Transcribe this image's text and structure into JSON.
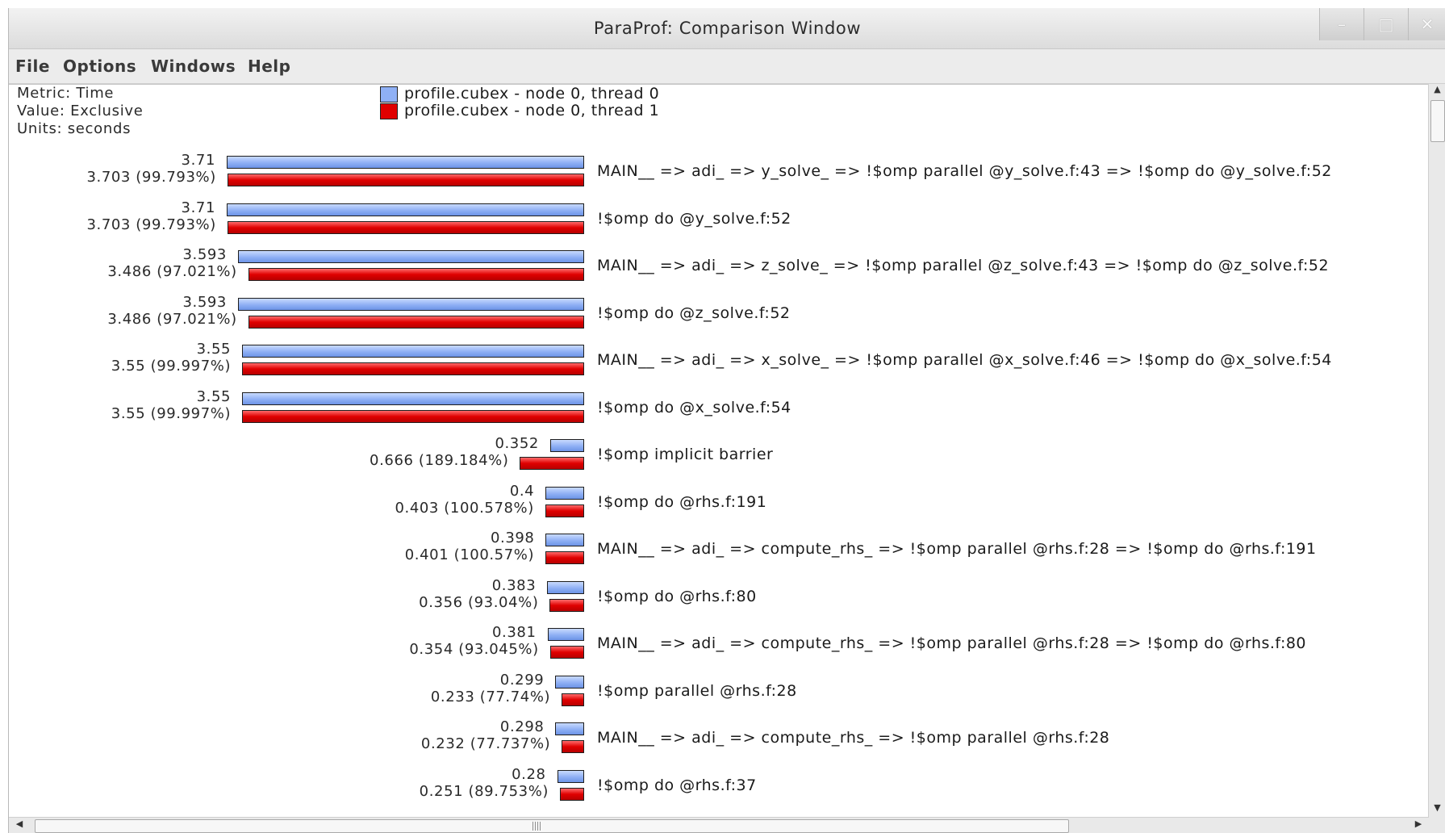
{
  "window": {
    "title": "ParaProf: Comparison Window",
    "controls": {
      "minimize": "–",
      "maximize": "□",
      "close": "✕"
    }
  },
  "menu": [
    "File",
    "Options",
    "Windows",
    "Help"
  ],
  "info": {
    "metric": "Metric: Time",
    "value": "Value: Exclusive",
    "units": "Units: seconds"
  },
  "legend": [
    {
      "label": "profile.cubex - node 0, thread 0",
      "color": "#8fb0f5"
    },
    {
      "label": "profile.cubex - node 0, thread 1",
      "color": "#e00000"
    }
  ],
  "scale_max": 3.71,
  "rows": [
    {
      "label": "MAIN__ => adi_ => y_solve_ => !$omp parallel @y_solve.f:43 => !$omp do @y_solve.f:52",
      "v0": 3.71,
      "v1": 3.703,
      "t0": "3.71",
      "t1": "3.703 (99.793%)"
    },
    {
      "label": "!$omp do @y_solve.f:52",
      "v0": 3.71,
      "v1": 3.703,
      "t0": "3.71",
      "t1": "3.703 (99.793%)"
    },
    {
      "label": "MAIN__ => adi_ => z_solve_ => !$omp parallel @z_solve.f:43 => !$omp do @z_solve.f:52",
      "v0": 3.593,
      "v1": 3.486,
      "t0": "3.593",
      "t1": "3.486 (97.021%)"
    },
    {
      "label": "!$omp do @z_solve.f:52",
      "v0": 3.593,
      "v1": 3.486,
      "t0": "3.593",
      "t1": "3.486 (97.021%)"
    },
    {
      "label": "MAIN__ => adi_ => x_solve_ => !$omp parallel @x_solve.f:46 => !$omp do @x_solve.f:54",
      "v0": 3.55,
      "v1": 3.55,
      "t0": "3.55",
      "t1": "3.55 (99.997%)"
    },
    {
      "label": "!$omp do @x_solve.f:54",
      "v0": 3.55,
      "v1": 3.55,
      "t0": "3.55",
      "t1": "3.55 (99.997%)"
    },
    {
      "label": "!$omp implicit barrier",
      "v0": 0.352,
      "v1": 0.666,
      "t0": "0.352",
      "t1": "0.666 (189.184%)"
    },
    {
      "label": "!$omp do @rhs.f:191",
      "v0": 0.4,
      "v1": 0.403,
      "t0": "0.4",
      "t1": "0.403 (100.578%)"
    },
    {
      "label": "MAIN__ => adi_ => compute_rhs_ => !$omp parallel @rhs.f:28 => !$omp do @rhs.f:191",
      "v0": 0.398,
      "v1": 0.401,
      "t0": "0.398",
      "t1": "0.401 (100.57%)"
    },
    {
      "label": "!$omp do @rhs.f:80",
      "v0": 0.383,
      "v1": 0.356,
      "t0": "0.383",
      "t1": "0.356 (93.04%)"
    },
    {
      "label": "MAIN__ => adi_ => compute_rhs_ => !$omp parallel @rhs.f:28 => !$omp do @rhs.f:80",
      "v0": 0.381,
      "v1": 0.354,
      "t0": "0.381",
      "t1": "0.354 (93.045%)"
    },
    {
      "label": "!$omp parallel @rhs.f:28",
      "v0": 0.299,
      "v1": 0.233,
      "t0": "0.299",
      "t1": "0.233 (77.74%)"
    },
    {
      "label": "MAIN__ => adi_ => compute_rhs_ => !$omp parallel @rhs.f:28",
      "v0": 0.298,
      "v1": 0.232,
      "t0": "0.298",
      "t1": "0.232 (77.737%)"
    },
    {
      "label": "!$omp do @rhs.f:37",
      "v0": 0.28,
      "v1": 0.251,
      "t0": "0.28",
      "t1": "0.251 (89.753%)"
    }
  ],
  "scrollbars": {
    "up": "▲",
    "down": "▼",
    "left": "◀",
    "right": "▶"
  }
}
